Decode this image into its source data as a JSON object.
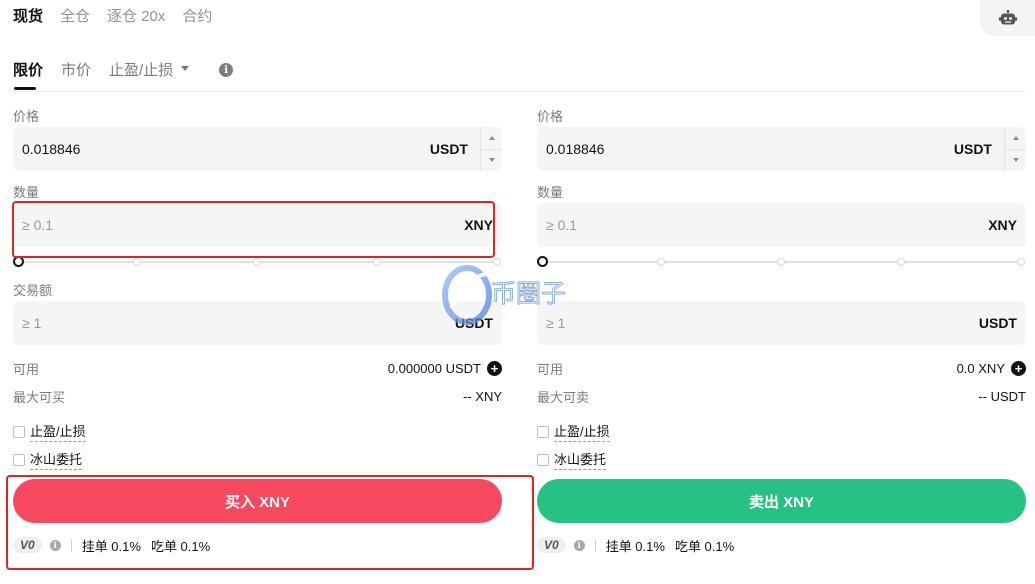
{
  "top_tabs": [
    "现货",
    "全仓",
    "逐仓 20x",
    "合约"
  ],
  "order_tabs": {
    "limit": "限价",
    "market": "市价",
    "tpsl": "止盈/止损"
  },
  "buy": {
    "price_label": "价格",
    "price_value": "0.018846",
    "price_unit": "USDT",
    "qty_label": "数量",
    "qty_placeholder": "≥ 0.1",
    "qty_unit": "XNY",
    "amount_label": "交易额",
    "amount_placeholder": "≥ 1",
    "amount_unit": "USDT",
    "available_label": "可用",
    "available_value": "0.000000 USDT",
    "max_label": "最大可买",
    "max_value": "-- XNY",
    "tpsl_label": "止盈/止损",
    "iceberg_label": "冰山委托",
    "button": "买入 XNY",
    "button_color": "#f6495f",
    "fee_level": "V0",
    "maker_fee": "挂单 0.1%",
    "taker_fee": "吃单 0.1%"
  },
  "sell": {
    "price_label": "价格",
    "price_value": "0.018846",
    "price_unit": "USDT",
    "qty_label": "数量",
    "qty_placeholder": "≥ 0.1",
    "qty_unit": "XNY",
    "amount_label": "",
    "amount_placeholder": "≥ 1",
    "amount_unit": "USDT",
    "available_label": "可用",
    "available_value": "0.0 XNY",
    "max_label": "最大可卖",
    "max_value": "-- USDT",
    "tpsl_label": "止盈/止损",
    "iceberg_label": "冰山委托",
    "button": "卖出 XNY",
    "button_color": "#27c283",
    "fee_level": "V0",
    "maker_fee": "挂单 0.1%",
    "taker_fee": "吃单 0.1%"
  },
  "slider_percent": 0,
  "watermark_text": "币圈子",
  "icons": {
    "bot": "robot-icon",
    "info": "info-icon",
    "plus": "plus-circle-icon",
    "caret": "caret-down-icon"
  },
  "highlight_color": "#e02323"
}
